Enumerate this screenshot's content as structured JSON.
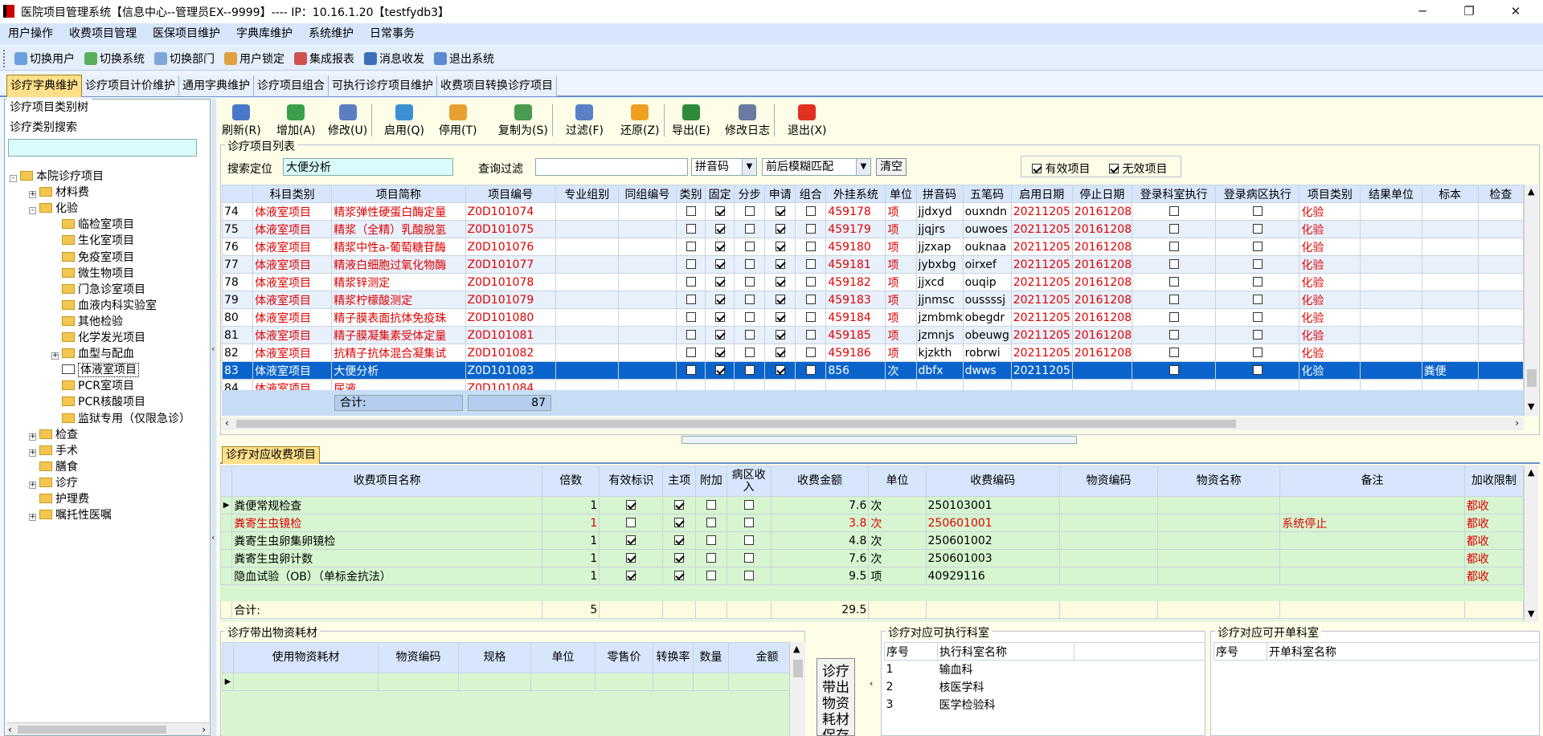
{
  "window": {
    "title": "医院项目管理系统【信息中心--管理员EX--9999】---- IP：10.16.1.20【testfydb3】",
    "min": "─",
    "max": "❐",
    "close": "✕"
  },
  "menu": [
    "用户操作",
    "收费项目管理",
    "医保项目维护",
    "字典库维护",
    "系统维护",
    "日常事务"
  ],
  "toolbar": [
    {
      "label": "切换用户",
      "icon": "switch-user-icon",
      "color": "#6aa0e0"
    },
    {
      "label": "切换系统",
      "icon": "switch-system-icon",
      "color": "#58b05a"
    },
    {
      "label": "切换部门",
      "icon": "switch-dept-icon",
      "color": "#7da7d9"
    },
    {
      "label": "用户锁定",
      "icon": "lock-user-icon",
      "color": "#e0a040"
    },
    {
      "label": "集成报表",
      "icon": "report-icon",
      "color": "#d05050"
    },
    {
      "label": "消息收发",
      "icon": "message-icon",
      "color": "#3d6fb8"
    },
    {
      "label": "退出系统",
      "icon": "exit-icon",
      "color": "#5a8ad0"
    }
  ],
  "tabs": [
    "诊疗字典维护",
    "诊疗项目计价维护",
    "通用字典维护",
    "诊疗项目组合",
    "可执行诊疗项目维护",
    "收费项目转换诊疗项目"
  ],
  "left": {
    "title": "诊疗项目类别树",
    "search_label": "诊疗类别搜索",
    "search_value": "",
    "tree": [
      {
        "label": "本院诊疗项目",
        "level": 0,
        "pm": "-"
      },
      {
        "label": "材料费",
        "level": 1,
        "pm": "+"
      },
      {
        "label": "化验",
        "level": 1,
        "pm": "-"
      },
      {
        "label": "临检室项目",
        "level": 2,
        "pm": ""
      },
      {
        "label": "生化室项目",
        "level": 2,
        "pm": ""
      },
      {
        "label": "免疫室项目",
        "level": 2,
        "pm": ""
      },
      {
        "label": "微生物项目",
        "level": 2,
        "pm": ""
      },
      {
        "label": "门急诊室项目",
        "level": 2,
        "pm": ""
      },
      {
        "label": "血液内科实验室",
        "level": 2,
        "pm": ""
      },
      {
        "label": "其他检验",
        "level": 2,
        "pm": ""
      },
      {
        "label": "化学发光项目",
        "level": 2,
        "pm": ""
      },
      {
        "label": "血型与配血",
        "level": 2,
        "pm": "+"
      },
      {
        "label": "体液室项目",
        "level": 2,
        "pm": "",
        "selected": true
      },
      {
        "label": "PCR室项目",
        "level": 2,
        "pm": ""
      },
      {
        "label": "PCR核酸项目",
        "level": 2,
        "pm": ""
      },
      {
        "label": "监狱专用（仅限急诊）",
        "level": 2,
        "pm": ""
      },
      {
        "label": "检查",
        "level": 1,
        "pm": "+"
      },
      {
        "label": "手术",
        "level": 1,
        "pm": "+"
      },
      {
        "label": "膳食",
        "level": 1,
        "pm": ""
      },
      {
        "label": "诊疗",
        "level": 1,
        "pm": "+"
      },
      {
        "label": "护理费",
        "level": 1,
        "pm": ""
      },
      {
        "label": "嘱托性医嘱",
        "level": 1,
        "pm": "+"
      }
    ]
  },
  "actions": [
    {
      "label": "刷新(R)",
      "icon": "refresh-icon",
      "color": "#4a78c8"
    },
    {
      "label": "增加(A)",
      "icon": "add-icon",
      "color": "#3aa04a"
    },
    {
      "label": "修改(U)",
      "icon": "edit-icon",
      "color": "#5a7ec0"
    },
    {
      "label": "启用(Q)",
      "icon": "enable-icon",
      "color": "#3a90d0"
    },
    {
      "label": "停用(T)",
      "icon": "disable-icon",
      "color": "#e8a030"
    },
    {
      "label": "复制为(S)",
      "icon": "copy-icon",
      "color": "#4a9a50"
    },
    {
      "label": "过滤(F)",
      "icon": "filter-icon",
      "color": "#5a80c8"
    },
    {
      "label": "还原(Z)",
      "icon": "restore-icon",
      "color": "#f0a020"
    },
    {
      "label": "导出(E)",
      "icon": "export-icon",
      "color": "#2f8a3a"
    },
    {
      "label": "修改日志",
      "icon": "log-icon",
      "color": "#6a7aa0"
    },
    {
      "label": "退出(X)",
      "icon": "power-icon",
      "color": "#e03020"
    }
  ],
  "list": {
    "title": "诊疗项目列表",
    "search_label": "搜索定位",
    "search_value": "大便分析",
    "filter_label": "查询过滤",
    "filter_value": "",
    "combo1": "拼音码",
    "combo2": "前后模糊匹配",
    "clear": "清空",
    "valid": "有效项目",
    "invalid": "无效项目",
    "columns": [
      "",
      "科目类别",
      "项目简称",
      "项目编号",
      "专业组别",
      "同组编号",
      "类别",
      "固定",
      "分步",
      "申请",
      "组合",
      "外挂系统",
      "单位",
      "拼音码",
      "五笔码",
      "启用日期",
      "停止日期",
      "登录科室执行",
      "登录病区执行",
      "项目类别",
      "结果单位",
      "标本",
      "检查"
    ],
    "rows": [
      {
        "no": "74",
        "cat": "体液室项目",
        "name": "精浆弹性硬蛋白酶定量",
        "code": "Z0D101074",
        "ext": "459178",
        "unit": "项",
        "py": "jjdxyd",
        "wb": "ouxndn",
        "start": "20211205",
        "stop": "20161208",
        "type": "化验",
        "spec": "",
        "red": true
      },
      {
        "no": "75",
        "cat": "体液室项目",
        "name": "精浆（全精）乳酸脱氢",
        "code": "Z0D101075",
        "ext": "459179",
        "unit": "项",
        "py": "jjqjrs",
        "wb": "ouwoes",
        "start": "20211205",
        "stop": "20161208",
        "type": "化验",
        "spec": "",
        "red": true
      },
      {
        "no": "76",
        "cat": "体液室项目",
        "name": "精浆中性a-葡萄糖苷酶",
        "code": "Z0D101076",
        "ext": "459180",
        "unit": "项",
        "py": "jjzxap",
        "wb": "ouknaa",
        "start": "20211205",
        "stop": "20161208",
        "type": "化验",
        "spec": "",
        "red": true
      },
      {
        "no": "77",
        "cat": "体液室项目",
        "name": "精液白细胞过氧化物酶",
        "code": "Z0D101077",
        "ext": "459181",
        "unit": "项",
        "py": "jybxbg",
        "wb": "oirxef",
        "start": "20211205",
        "stop": "20161208",
        "type": "化验",
        "spec": "",
        "red": true
      },
      {
        "no": "78",
        "cat": "体液室项目",
        "name": "精浆锌测定",
        "code": "Z0D101078",
        "ext": "459182",
        "unit": "项",
        "py": "jjxcd",
        "wb": "ouqip",
        "start": "20211205",
        "stop": "20161208",
        "type": "化验",
        "spec": "",
        "red": true
      },
      {
        "no": "79",
        "cat": "体液室项目",
        "name": "精浆柠檬酸测定",
        "code": "Z0D101079",
        "ext": "459183",
        "unit": "项",
        "py": "jjnmsc",
        "wb": "oussssj",
        "start": "20211205",
        "stop": "20161208",
        "type": "化验",
        "spec": "",
        "red": true
      },
      {
        "no": "80",
        "cat": "体液室项目",
        "name": "精子膜表面抗体免疫珠",
        "code": "Z0D101080",
        "ext": "459184",
        "unit": "项",
        "py": "jzmbmk",
        "wb": "obegdr",
        "start": "20211205",
        "stop": "20161208",
        "type": "化验",
        "spec": "",
        "red": true
      },
      {
        "no": "81",
        "cat": "体液室项目",
        "name": "精子膜凝集素受体定量",
        "code": "Z0D101081",
        "ext": "459185",
        "unit": "项",
        "py": "jzmnjs",
        "wb": "obeuwg",
        "start": "20211205",
        "stop": "20161208",
        "type": "化验",
        "spec": "",
        "red": true
      },
      {
        "no": "82",
        "cat": "体液室项目",
        "name": "抗精子抗体混合凝集试",
        "code": "Z0D101082",
        "ext": "459186",
        "unit": "项",
        "py": "kjzkth",
        "wb": "robrwi",
        "start": "20211205",
        "stop": "20161208",
        "type": "化验",
        "spec": "",
        "red": true
      },
      {
        "no": "83",
        "cat": "体液室项目",
        "name": "大便分析",
        "code": "Z0D101083",
        "ext": "856",
        "unit": "次",
        "py": "dbfx",
        "wb": "dwws",
        "start": "20211205",
        "stop": "",
        "type": "化验",
        "spec": "粪便",
        "red": false,
        "selected": true
      }
    ],
    "partial_row": {
      "no": "84",
      "cat": "体液室项目",
      "name": "尿液",
      "code": "Z0D101084"
    },
    "total_label": "合计:",
    "total_value": "87"
  },
  "charge": {
    "tab": "诊疗对应收费项目",
    "columns": [
      "",
      "收费项目名称",
      "倍数",
      "有效标识",
      "主项",
      "附加",
      "病区收入",
      "收费金额",
      "单位",
      "收费编码",
      "物资编码",
      "物资名称",
      "备注",
      "加收限制"
    ],
    "rows": [
      {
        "name": "粪便常规检查",
        "mult": "1",
        "valid": true,
        "main": true,
        "add": false,
        "ward": false,
        "amount": "7.6",
        "unit": "次",
        "code": "250103001",
        "remark": "",
        "limit": "都收",
        "red": false
      },
      {
        "name": "粪寄生虫镜检",
        "mult": "1",
        "valid": false,
        "main": true,
        "add": false,
        "ward": false,
        "amount": "3.8",
        "unit": "次",
        "code": "250601001",
        "remark": "系统停止",
        "limit": "都收",
        "red": true
      },
      {
        "name": "粪寄生虫卵集卵镜检",
        "mult": "1",
        "valid": true,
        "main": true,
        "add": false,
        "ward": false,
        "amount": "4.8",
        "unit": "次",
        "code": "250601002",
        "remark": "",
        "limit": "都收",
        "red": false
      },
      {
        "name": "粪寄生虫卵计数",
        "mult": "1",
        "valid": true,
        "main": true,
        "add": false,
        "ward": false,
        "amount": "7.6",
        "unit": "次",
        "code": "250601003",
        "remark": "",
        "limit": "都收",
        "red": false
      },
      {
        "name": "隐血试验（OB）（单标金抗法）",
        "mult": "1",
        "valid": true,
        "main": true,
        "add": false,
        "ward": false,
        "amount": "9.5",
        "unit": "项",
        "code": "40929116",
        "remark": "",
        "limit": "都收",
        "red": false
      }
    ],
    "total_label": "合计:",
    "total_mult": "5",
    "total_amount": "29.5"
  },
  "materials": {
    "title": "诊疗带出物资耗材",
    "columns": [
      "",
      "使用物资耗材",
      "物资编码",
      "规格",
      "单位",
      "零售价",
      "转换率",
      "数量",
      "金额"
    ],
    "save_label": "诊疗带出物资耗材保存"
  },
  "exec_dept": {
    "title": "诊疗对应可执行科室",
    "columns": [
      "序号",
      "执行科室名称"
    ],
    "rows": [
      {
        "no": "1",
        "name": "输血科"
      },
      {
        "no": "2",
        "name": "核医学科"
      },
      {
        "no": "3",
        "name": "医学检验科"
      }
    ]
  },
  "order_dept": {
    "title": "诊疗对应可开单科室",
    "columns": [
      "序号",
      "开单科室名称"
    ]
  }
}
